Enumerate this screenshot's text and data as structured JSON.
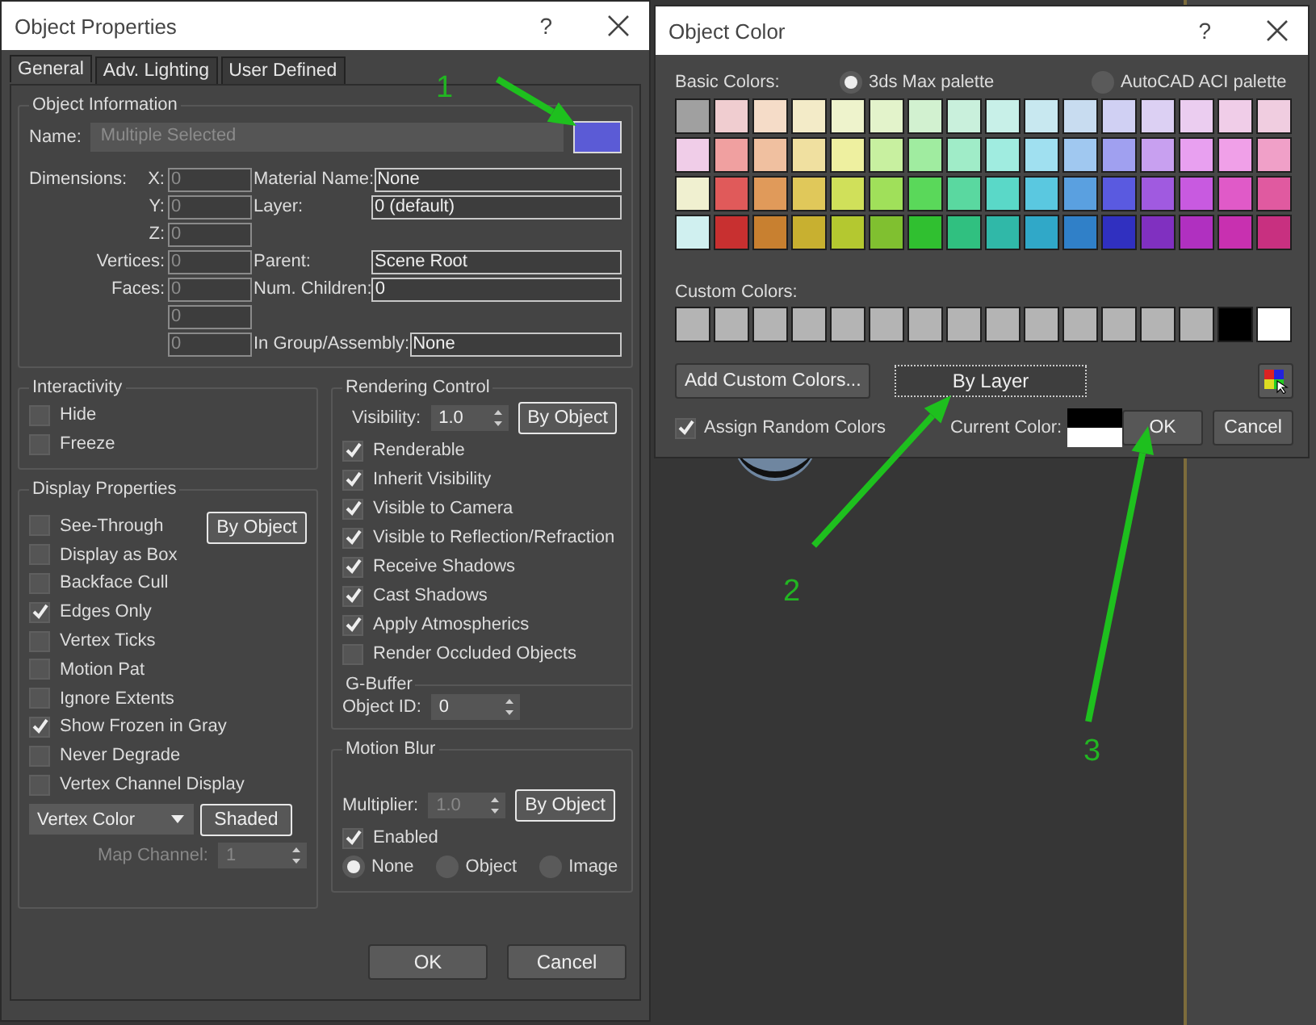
{
  "object_properties": {
    "title": "Object Properties",
    "help": "?",
    "tabs": [
      {
        "label": "General",
        "selected": true
      },
      {
        "label": "Adv. Lighting",
        "selected": false
      },
      {
        "label": "User Defined",
        "selected": false
      }
    ],
    "info": {
      "title": "Object Information",
      "name_label": "Name:",
      "name_value": "Multiple Selected",
      "name_disabled": true,
      "color": "#5b5bd6",
      "rows": [
        {
          "label": "Dimensions:",
          "axis": "X:",
          "value": "0",
          "prop_label": "Material Name:",
          "prop_value": "None"
        },
        {
          "axis": "Y:",
          "value": "0",
          "prop_label": "Layer:",
          "prop_value": "0 (default)"
        },
        {
          "axis": "Z:",
          "value": "0"
        },
        {
          "axis": "Vertices:",
          "value": "0",
          "prop_label": "Parent:",
          "prop_value": "Scene Root"
        },
        {
          "axis": "Faces:",
          "value": "0",
          "prop_label": "Num. Children:",
          "prop_value": "0"
        },
        {
          "value": "0"
        },
        {
          "value": "0",
          "prop_label": "In Group/Assembly:",
          "prop_value": "None"
        }
      ]
    },
    "interactivity": {
      "title": "Interactivity",
      "options": [
        {
          "label": "Hide",
          "checked": false
        },
        {
          "label": "Freeze",
          "checked": false
        }
      ]
    },
    "display": {
      "title": "Display Properties",
      "button": "By Object",
      "options": [
        {
          "label": "See-Through",
          "checked": false
        },
        {
          "label": "Display as Box",
          "checked": false
        },
        {
          "label": "Backface Cull",
          "checked": false
        },
        {
          "label": "Edges Only",
          "checked": true
        },
        {
          "label": "Vertex Ticks",
          "checked": false
        },
        {
          "label": "Motion Pat",
          "checked": false
        },
        {
          "label": "Ignore Extents",
          "checked": false
        },
        {
          "label": "Show Frozen in Gray",
          "checked": true
        },
        {
          "label": "Never Degrade",
          "checked": false
        },
        {
          "label": "Vertex Channel Display",
          "checked": false
        }
      ],
      "dropdown": "Vertex Color",
      "shade_button": "Shaded",
      "map_channel_label": "Map Channel:",
      "map_channel_value": "1"
    },
    "rendering": {
      "title": "Rendering Control",
      "visibility_label": "Visibility:",
      "visibility_value": "1.0",
      "button": "By Object",
      "options": [
        {
          "label": "Renderable",
          "checked": true
        },
        {
          "label": "Inherit Visibility",
          "checked": true
        },
        {
          "label": "Visible to Camera",
          "checked": true
        },
        {
          "label": "Visible to Reflection/Refraction",
          "checked": true
        },
        {
          "label": "Receive Shadows",
          "checked": true
        },
        {
          "label": "Cast Shadows",
          "checked": true
        },
        {
          "label": "Apply Atmospherics",
          "checked": true
        },
        {
          "label": "Render Occluded Objects",
          "checked": false
        }
      ]
    },
    "gbuffer": {
      "title": "G-Buffer",
      "label": "Object ID:",
      "value": "0"
    },
    "motion_blur": {
      "title": "Motion Blur",
      "multiplier_label": "Multiplier:",
      "multiplier_value": "1.0",
      "button": "By Object",
      "enabled_label": "Enabled",
      "enabled": true,
      "modes": [
        {
          "label": "None",
          "selected": true
        },
        {
          "label": "Object",
          "selected": false
        },
        {
          "label": "Image",
          "selected": false
        }
      ]
    },
    "buttons": [
      "OK",
      "Cancel"
    ]
  },
  "object_color": {
    "title": "Object Color",
    "help": "?",
    "basic_label": "Basic Colors:",
    "palettes": [
      {
        "label": "3ds Max palette",
        "selected": true
      },
      {
        "label": "AutoCAD ACI palette",
        "selected": false
      }
    ],
    "basic_colors": [
      {
        "color": "#a0a0a0"
      },
      {
        "color": "#f0cdd0"
      },
      {
        "color": "#f5dcc8"
      },
      {
        "color": "#f3ebc8"
      },
      {
        "color": "#eef3cc"
      },
      {
        "color": "#e3f3cb"
      },
      {
        "color": "#d2f1d0"
      },
      {
        "color": "#c9f0dc"
      },
      {
        "color": "#c8f0e8"
      },
      {
        "color": "#c8e8f0"
      },
      {
        "color": "#c8dcf0"
      },
      {
        "color": "#d0d0f3"
      },
      {
        "color": "#dcd0f3"
      },
      {
        "color": "#ebcdf0"
      },
      {
        "color": "#f0cde8"
      },
      {
        "color": "#f0cde0"
      },
      {
        "color": "#f0cde8"
      },
      {
        "color": "#f0a0a0"
      },
      {
        "color": "#f0c0a0"
      },
      {
        "color": "#f0e0a0"
      },
      {
        "color": "#eef0a0"
      },
      {
        "color": "#c8f0a0"
      },
      {
        "color": "#a0eca0"
      },
      {
        "color": "#a0ecc8"
      },
      {
        "color": "#a0ece0"
      },
      {
        "color": "#a0e0f0"
      },
      {
        "color": "#a0c8f0"
      },
      {
        "color": "#a0a0f0"
      },
      {
        "color": "#c8a0f0"
      },
      {
        "color": "#e8a0f0"
      },
      {
        "color": "#f0a0e8"
      },
      {
        "color": "#f0a0c8"
      },
      {
        "color": "#f0f0d0"
      },
      {
        "color": "#e05a5a"
      },
      {
        "color": "#e09a5a"
      },
      {
        "color": "#e0c85a"
      },
      {
        "color": "#d0e05a"
      },
      {
        "color": "#a0e05a"
      },
      {
        "color": "#5ad85a"
      },
      {
        "color": "#5ad8a0"
      },
      {
        "color": "#5ad8c8"
      },
      {
        "color": "#5ac8e0"
      },
      {
        "color": "#5aa0e0"
      },
      {
        "color": "#5a5ae0"
      },
      {
        "color": "#a05ae0"
      },
      {
        "color": "#c85ae0"
      },
      {
        "color": "#e05ac8"
      },
      {
        "color": "#e05aa0"
      },
      {
        "color": "#d0f0f0"
      },
      {
        "color": "#c83030"
      },
      {
        "color": "#c88030"
      },
      {
        "color": "#c8b030"
      },
      {
        "color": "#b4c830"
      },
      {
        "color": "#80c030"
      },
      {
        "color": "#30c030"
      },
      {
        "color": "#30c080"
      },
      {
        "color": "#30b8a8"
      },
      {
        "color": "#30a8c8"
      },
      {
        "color": "#3080c8"
      },
      {
        "color": "#3030c0"
      },
      {
        "color": "#8030c0"
      },
      {
        "color": "#b030c0"
      },
      {
        "color": "#c830b0"
      },
      {
        "color": "#c83080"
      }
    ],
    "custom_label": "Custom Colors:",
    "custom_colors": [
      {
        "color": "#b4b4b4"
      },
      {
        "color": "#b4b4b4"
      },
      {
        "color": "#b4b4b4"
      },
      {
        "color": "#b4b4b4"
      },
      {
        "color": "#b4b4b4"
      },
      {
        "color": "#b4b4b4"
      },
      {
        "color": "#b4b4b4"
      },
      {
        "color": "#b4b4b4"
      },
      {
        "color": "#b4b4b4"
      },
      {
        "color": "#b4b4b4"
      },
      {
        "color": "#b4b4b4"
      },
      {
        "color": "#b4b4b4"
      },
      {
        "color": "#b4b4b4"
      },
      {
        "color": "#b4b4b4"
      },
      {
        "color": "#000000"
      },
      {
        "color": "#ffffff"
      }
    ],
    "add_button": "Add Custom Colors...",
    "by_layer_button": "By Layer",
    "random": {
      "label": "Assign Random Colors",
      "checked": true
    },
    "current_label": "Current Color:",
    "buttons": [
      "OK",
      "Cancel"
    ]
  },
  "annotations": [
    {
      "label": "1"
    },
    {
      "label": "2"
    },
    {
      "label": "3"
    }
  ]
}
